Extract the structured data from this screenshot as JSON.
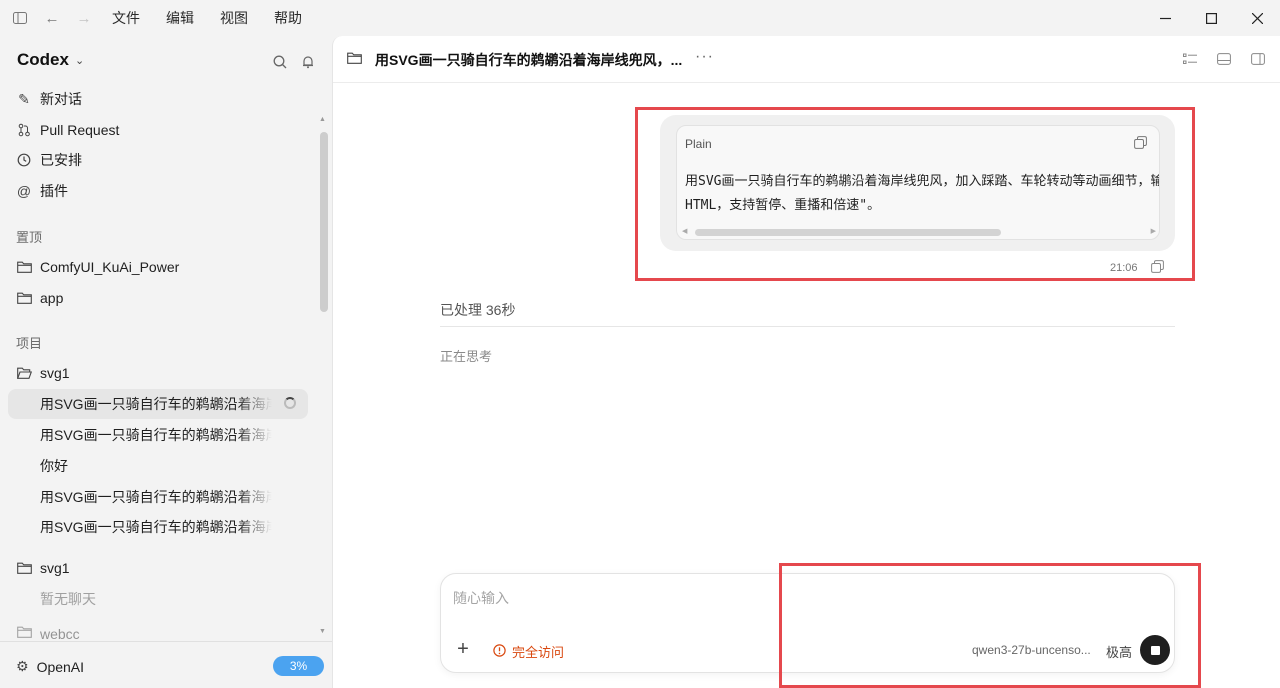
{
  "titlebar": {
    "menu": [
      "文件",
      "编辑",
      "视图",
      "帮助"
    ]
  },
  "sidebar": {
    "brand": "Codex",
    "nav": [
      {
        "label": "新对话",
        "icon": "edit-icon"
      },
      {
        "label": "Pull Request",
        "icon": "git-pull-request-icon"
      },
      {
        "label": "已安排",
        "icon": "clock-icon"
      },
      {
        "label": "插件",
        "icon": "at-icon"
      }
    ],
    "pinned_title": "置顶",
    "pinned": [
      "ComfyUI_KuAi_Power",
      "app"
    ],
    "projects_title": "项目",
    "project1": {
      "name": "svg1",
      "chats": [
        "用SVG画一只骑自行车的鹈鹕沿着海岸线兜风",
        "用SVG画一只骑自行车的鹈鹕沿着海岸线兜风",
        "你好",
        "用SVG画一只骑自行车的鹈鹕沿着海岸线兜风",
        "用SVG画一只骑自行车的鹈鹕沿着海岸线兜风"
      ]
    },
    "project2": {
      "name": "svg1",
      "empty": "暂无聊天"
    },
    "project3": {
      "name": "webcc"
    },
    "account": "OpenAI",
    "usage": "3%"
  },
  "header": {
    "title": "用SVG画一只骑自行车的鹈鹕沿着海岸线兜风，..."
  },
  "message": {
    "code_lang": "Plain",
    "code_line1": "用SVG画一只骑自行车的鹈鹕沿着海岸线兜风，加入踩踏、车轮转动等动画细节，输出为单个",
    "code_line2": "HTML，支持暂停、重播和倍速\"。",
    "time": "21:06"
  },
  "status": {
    "processed": "已处理 36秒",
    "thinking": "正在思考"
  },
  "composer": {
    "placeholder": "随心输入",
    "access": "完全访问",
    "model": "qwen3-27b-uncenso...",
    "effort": "极高"
  },
  "colors": {
    "accent": "#4ba3f0",
    "warning": "#d9480f",
    "annotation": "#e5484d"
  }
}
